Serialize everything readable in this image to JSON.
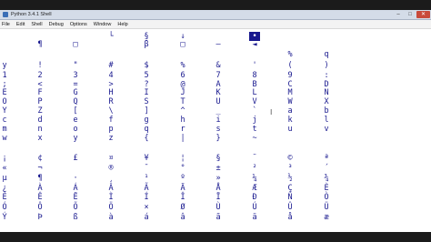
{
  "window": {
    "title": "Python 3.4.1 Shell",
    "controls": {
      "minimize": "–",
      "maximize": "□",
      "close": "✕"
    }
  },
  "menu": [
    "File",
    "Edit",
    "Shell",
    "Debug",
    "Options",
    "Window",
    "Help"
  ],
  "shell": {
    "text_cursor_icon": "I-beam-cursor",
    "selected_glyph": "•",
    "glyph_rows": [
      [
        "",
        "",
        "",
        "└",
        "§",
        "↓",
        "",
        "•",
        "",
        ""
      ],
      [
        "",
        "¶",
        "□",
        "",
        "β",
        "□",
        "—",
        "◄",
        "",
        ""
      ],
      [
        "",
        "",
        "",
        "",
        "",
        "",
        "",
        "",
        "%",
        "q"
      ],
      [
        "y",
        "!",
        "\"",
        "#",
        "$",
        "%",
        "&",
        "'",
        "(",
        ")"
      ],
      [
        "1",
        "2",
        "3",
        "4",
        "5",
        "6",
        "7",
        "8",
        "9",
        ":"
      ],
      [
        ";",
        "<",
        "=",
        ">",
        "?",
        "@",
        "A",
        "B",
        "C",
        "D"
      ],
      [
        "E",
        "F",
        "G",
        "H",
        "I",
        "J",
        "K",
        "L",
        "M",
        "N"
      ],
      [
        "O",
        "P",
        "Q",
        "R",
        "S",
        "T",
        "U",
        "V",
        "W",
        "X"
      ],
      [
        "Y",
        "Z",
        "[",
        "\\",
        "]",
        "^",
        "_",
        "`",
        "a",
        "b"
      ],
      [
        "c",
        "d",
        "e",
        "f",
        "g",
        "h",
        "i",
        "j",
        "k",
        "l"
      ],
      [
        "m",
        "n",
        "o",
        "p",
        "q",
        "r",
        "s",
        "t",
        "u",
        "v"
      ],
      [
        "w",
        "x",
        "y",
        "z",
        "{",
        "|",
        "}",
        "~",
        "",
        ""
      ],
      [
        "¡",
        "¢",
        "£",
        "¤",
        "¥",
        "¦",
        "§",
        "¨",
        "©",
        "ª"
      ],
      [
        "«",
        "¬",
        "­",
        "®",
        "¯",
        "°",
        "±",
        "²",
        "³",
        "´"
      ],
      [
        "µ",
        "¶",
        "·",
        "¸",
        "¹",
        "º",
        "»",
        "¼",
        "½",
        "¾"
      ],
      [
        "¿",
        "À",
        "Á",
        "Â",
        "Ã",
        "Ä",
        "Å",
        "Æ",
        "Ç",
        "È"
      ],
      [
        "É",
        "Ê",
        "Ë",
        "Ì",
        "Í",
        "Î",
        "Ï",
        "Ð",
        "Ñ",
        "Ò"
      ],
      [
        "Ó",
        "Ô",
        "Õ",
        "Ö",
        "×",
        "Ø",
        "Ù",
        "Ú",
        "Û",
        "Ü"
      ],
      [
        "Ý",
        "Þ",
        "ß",
        "à",
        "á",
        "â",
        "ã",
        "ä",
        "å",
        "æ"
      ]
    ]
  }
}
